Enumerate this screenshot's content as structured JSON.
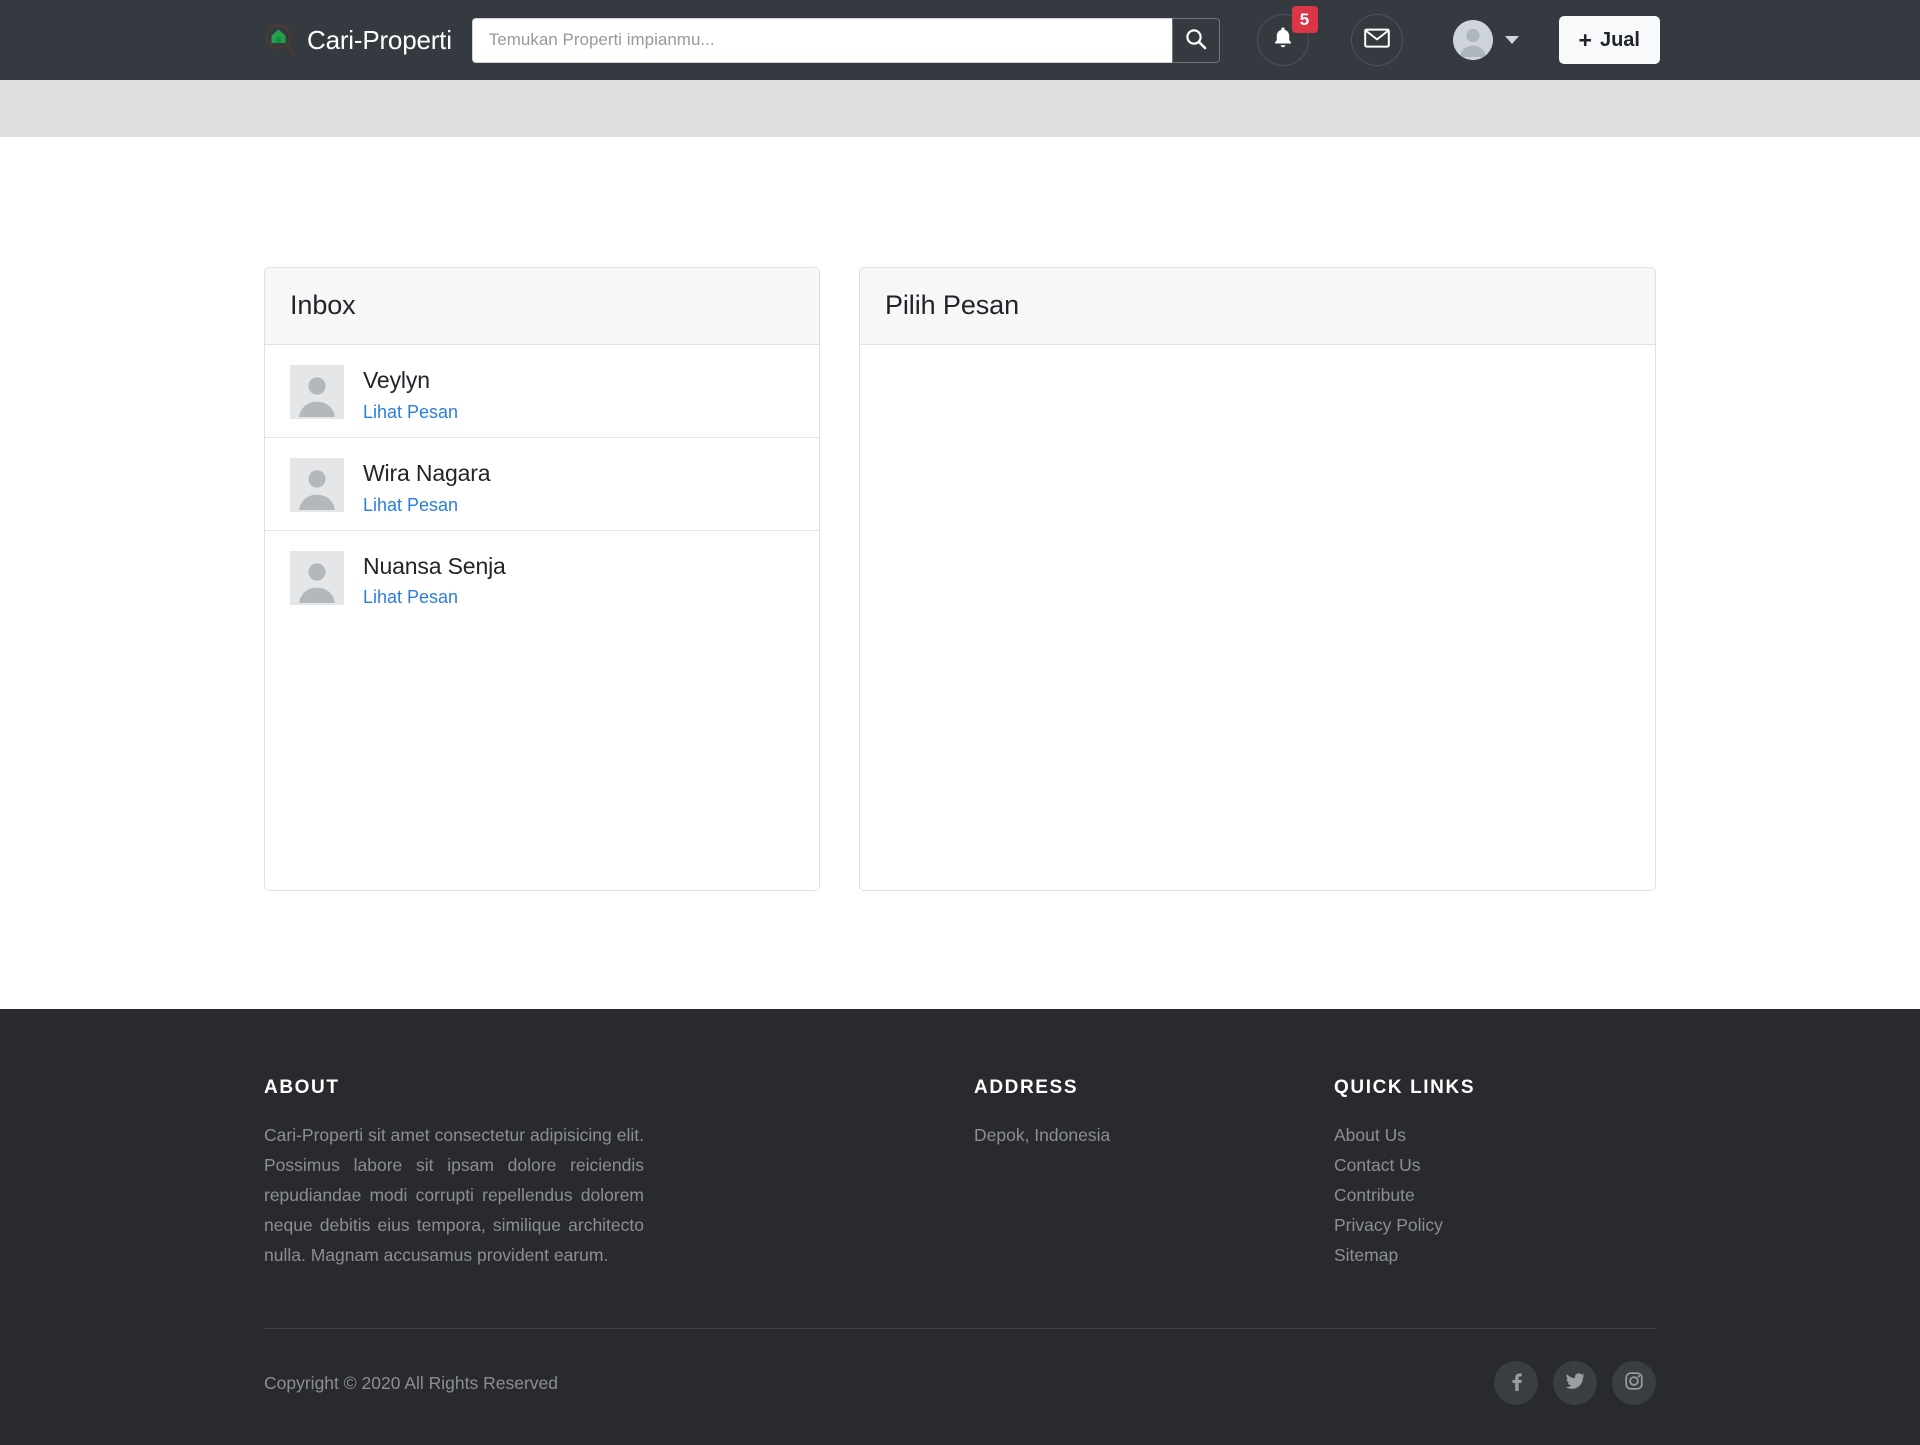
{
  "navbar": {
    "brand_name": "Cari-Properti",
    "brand_logo_icon": "house-magnifier-icon",
    "search": {
      "placeholder": "Temukan Properti impianmu...",
      "value": "",
      "button_icon": "search-icon"
    },
    "notifications": {
      "icon": "bell-icon",
      "badge_count": "5",
      "badge_color": "#dc3545"
    },
    "messages": {
      "icon": "envelope-icon"
    },
    "account": {
      "avatar_icon": "user-avatar-icon",
      "caret_icon": "caret-down-icon"
    },
    "sell_button": {
      "label": "Jual",
      "icon": "plus-icon"
    }
  },
  "main": {
    "inbox_panel": {
      "title": "Inbox",
      "items": [
        {
          "name": "Veylyn",
          "link_label": "Lihat Pesan",
          "avatar_icon": "user-placeholder-icon"
        },
        {
          "name": "Wira Nagara",
          "link_label": "Lihat Pesan",
          "avatar_icon": "user-placeholder-icon"
        },
        {
          "name": "Nuansa Senja",
          "link_label": "Lihat Pesan",
          "avatar_icon": "user-placeholder-icon"
        }
      ]
    },
    "message_panel": {
      "title": "Pilih Pesan",
      "body": ""
    }
  },
  "footer": {
    "about": {
      "heading": "ABOUT",
      "text": "Cari-Properti sit amet consectetur adipisicing elit. Possimus labore sit ipsam dolore reiciendis repudiandae modi corrupti repellendus dolorem neque debitis eius tempora, similique architecto nulla. Magnam accusamus provident earum."
    },
    "address": {
      "heading": "ADDRESS",
      "text": "Depok, Indonesia"
    },
    "quick_links": {
      "heading": "QUICK LINKS",
      "items": [
        {
          "label": "About Us"
        },
        {
          "label": "Contact Us"
        },
        {
          "label": "Contribute"
        },
        {
          "label": "Privacy Policy"
        },
        {
          "label": "Sitemap"
        }
      ]
    },
    "copyright": "Copyright © 2020 All Rights Reserved",
    "socials": [
      {
        "icon": "facebook-icon"
      },
      {
        "icon": "twitter-icon"
      },
      {
        "icon": "instagram-icon"
      }
    ]
  },
  "colors": {
    "navbar_bg": "#343a40",
    "subbar_bg": "#dfdfdf",
    "footer_bg": "#282a2e",
    "link_blue": "#2a7fdb",
    "brand_green": "#28a745",
    "badge_red": "#dc3545"
  }
}
